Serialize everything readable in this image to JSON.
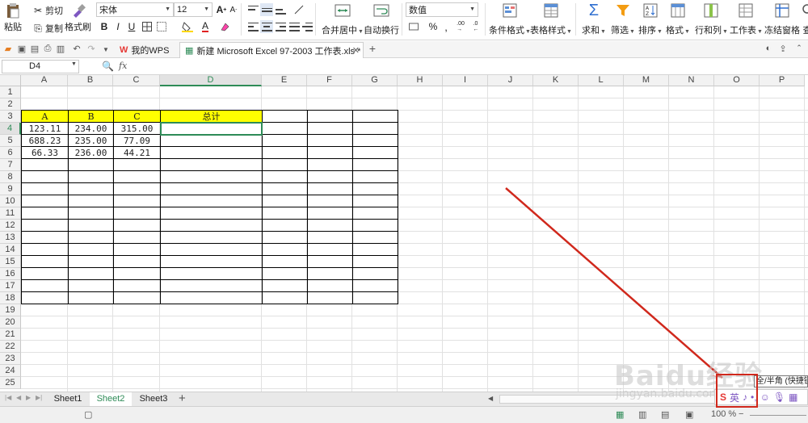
{
  "ribbon": {
    "paste": "粘贴",
    "cut": "剪切",
    "copy": "复制",
    "format_painter": "格式刷",
    "font_name": "宋体",
    "font_size": "12",
    "bold": "B",
    "italic": "I",
    "underline": "U",
    "merge_center": "合并居中",
    "wrap_text": "自动换行",
    "number_format": "数值",
    "percent": "%",
    "comma": ",",
    "conditional_format": "条件格式",
    "table_style": "表格样式",
    "sum": "求和",
    "filter": "筛选",
    "sort": "排序",
    "format": "格式",
    "rows_cols": "行和列",
    "worksheet": "工作表",
    "freeze_panes": "冻结窗格",
    "find": "查"
  },
  "tabs": {
    "wps_tab": "我的WPS",
    "doc_tab": "新建 Microsoft Excel 97-2003 工作表.xls *"
  },
  "formula_bar": {
    "name_box": "D4",
    "fx": "fx",
    "value": ""
  },
  "columns": [
    "A",
    "B",
    "C",
    "D",
    "E",
    "F",
    "G",
    "H",
    "I",
    "J",
    "K",
    "L",
    "M",
    "N",
    "O",
    "P"
  ],
  "rows": [
    "1",
    "2",
    "3",
    "4",
    "5",
    "6",
    "7",
    "8",
    "9",
    "10",
    "11",
    "12",
    "13",
    "14",
    "15",
    "16",
    "17",
    "18",
    "19",
    "20",
    "21",
    "22",
    "23",
    "24",
    "25"
  ],
  "cells": {
    "a3": "A",
    "b3": "B",
    "c3": "C",
    "d3": "总计",
    "a4": "123.11",
    "b4": "234.00",
    "c4": "315.00",
    "a5": "688.23",
    "b5": "235.00",
    "c5": "77.09",
    "a6": "66.33",
    "b6": "236.00",
    "c6": "44.21"
  },
  "sheets": [
    "Sheet1",
    "Sheet2",
    "Sheet3"
  ],
  "active_sheet": "Sheet2",
  "status": {
    "zoom": "100 %"
  },
  "ime": {
    "tooltip": "全/半角 (快捷键",
    "highlight_color": "#d0281c"
  },
  "watermark": {
    "text": "Baidu经验",
    "url": "jingyan.baidu.com"
  },
  "colors": {
    "header_fill": "#ffff00",
    "selection": "#2e8b57",
    "arrow": "#d0281c"
  }
}
